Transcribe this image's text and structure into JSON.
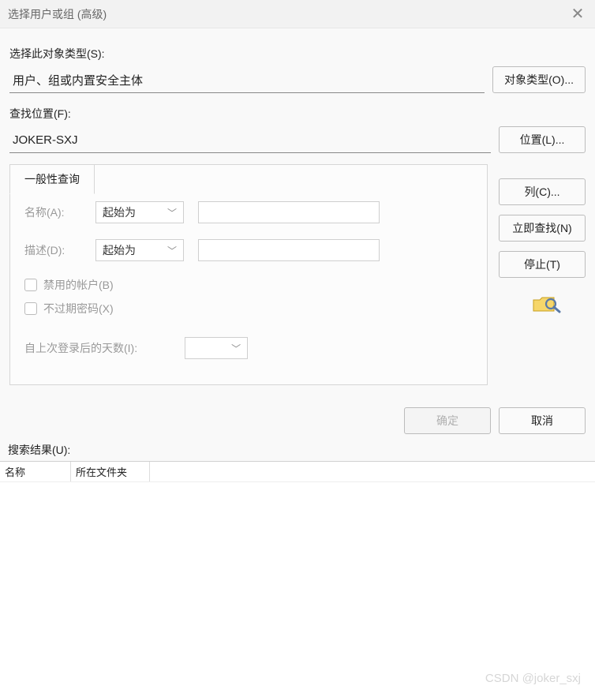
{
  "titlebar": {
    "title": "选择用户或组 (高级)"
  },
  "object_type": {
    "label": "选择此对象类型(S):",
    "value": "用户、组或内置安全主体",
    "button": "对象类型(O)..."
  },
  "location": {
    "label": "查找位置(F):",
    "value": "JOKER-SXJ",
    "button": "位置(L)..."
  },
  "query": {
    "tab_label": "一般性查询",
    "name_label": "名称(A):",
    "name_mode": "起始为",
    "desc_label": "描述(D):",
    "desc_mode": "起始为",
    "chk_disabled": "禁用的帐户(B)",
    "chk_noexpire": "不过期密码(X)",
    "days_label": "自上次登录后的天数(I):"
  },
  "side": {
    "columns": "列(C)...",
    "find_now": "立即查找(N)",
    "stop": "停止(T)"
  },
  "footer": {
    "ok": "确定",
    "cancel": "取消"
  },
  "results": {
    "label": "搜索结果(U):",
    "col_name": "名称",
    "col_folder": "所在文件夹"
  },
  "watermark": "CSDN @joker_sxj"
}
